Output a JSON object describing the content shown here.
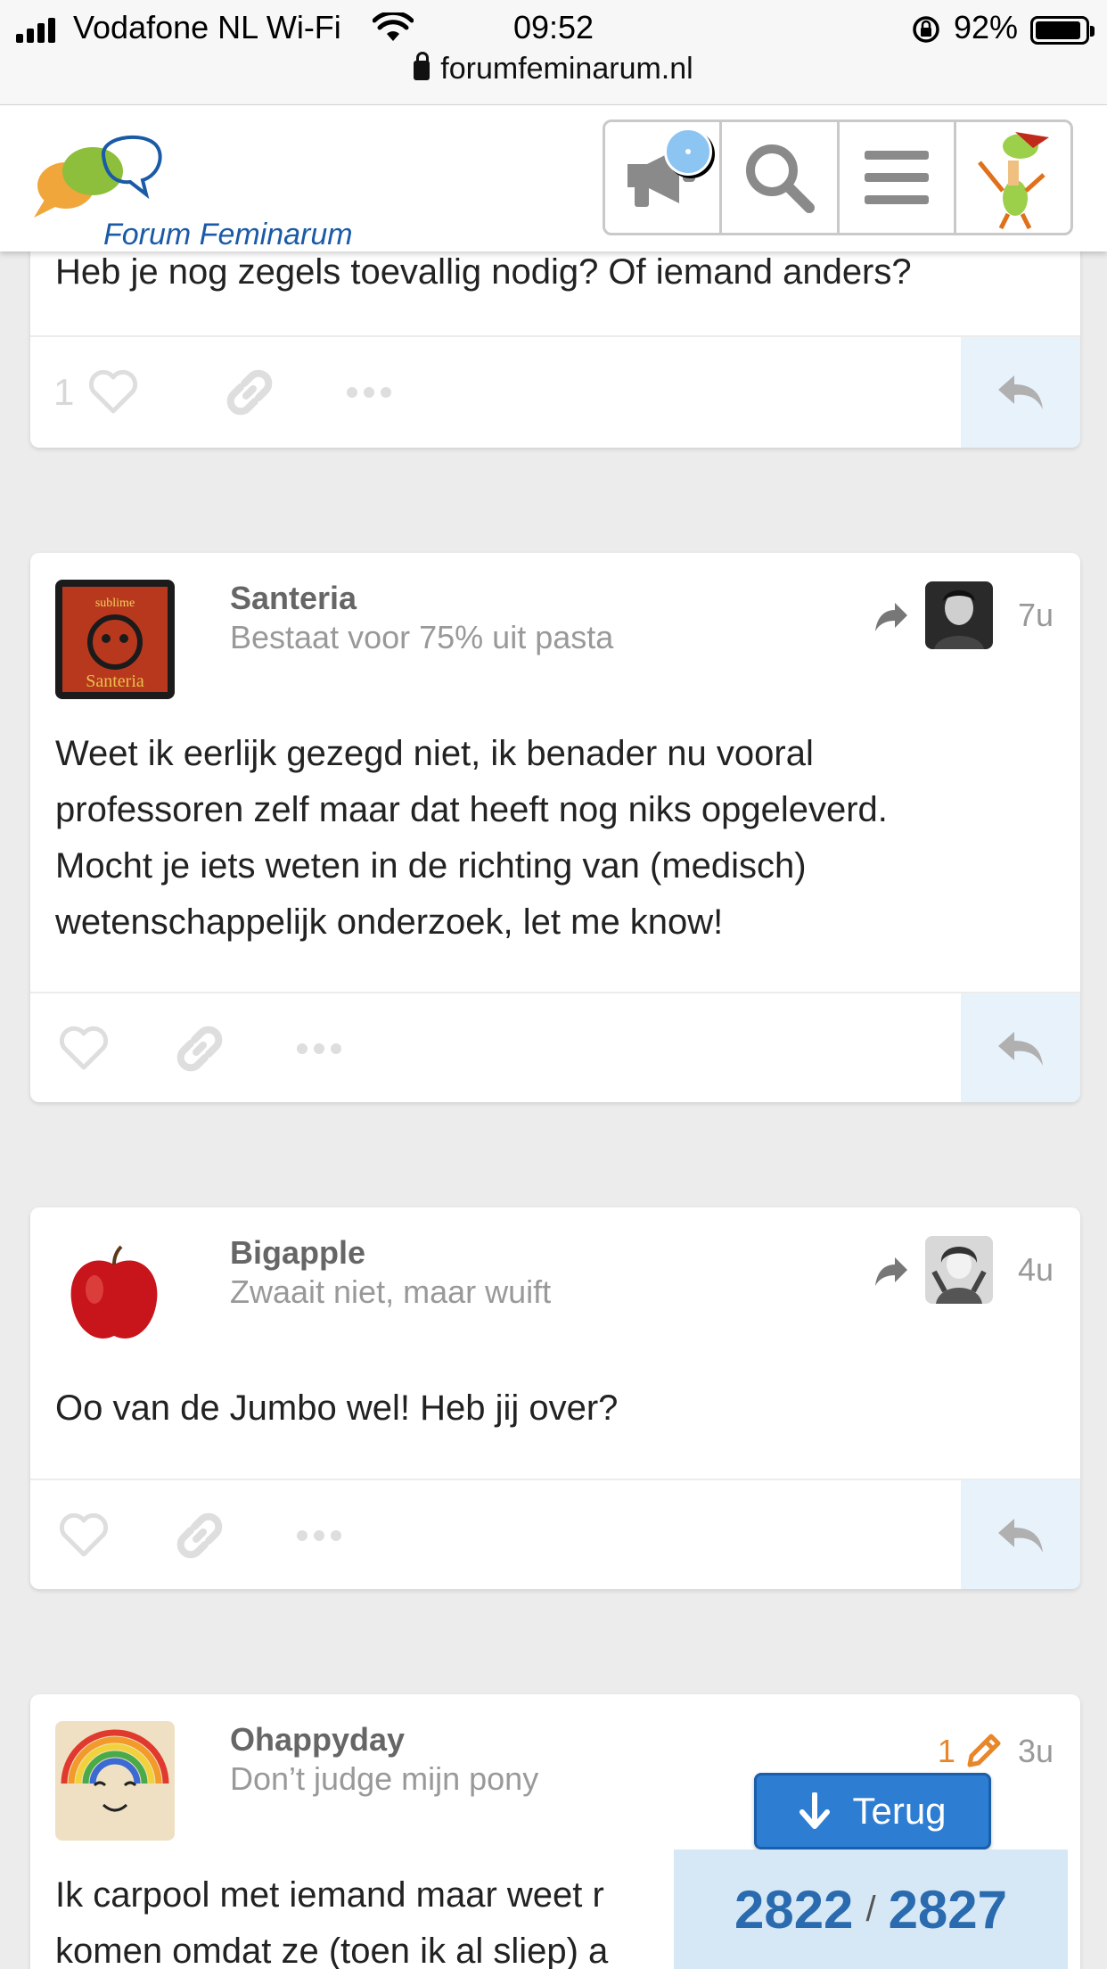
{
  "status_bar": {
    "carrier": "Vodafone NL Wi-Fi",
    "time": "09:52",
    "battery": "92%",
    "url": "forumfeminarum.nl"
  },
  "header": {
    "logo_text": "Forum Feminarum",
    "buttons": [
      "megaphone-icon",
      "search-icon",
      "hamburger-menu-icon",
      "user-avatar-frog"
    ],
    "accent_color": "#2d7dd2"
  },
  "previous_post": {
    "text": "Heb je nog zegels toevallig nodig? Of iemand anders?",
    "like_count": "1"
  },
  "posts": [
    {
      "username": "Santeria",
      "title": "Bestaat voor 75% uit pasta",
      "age": "7u",
      "avatar_text_top": "sublime",
      "avatar_text_bottom": "Santeria",
      "lines": [
        "Weet ik eerlijk gezegd niet, ik benader nu vooral",
        "professoren zelf maar dat heeft nog niks opgeleverd.",
        "Mocht je iets weten in de richting van (medisch)",
        "wetenschappelijk onderzoek, let me know!"
      ]
    },
    {
      "username": "Bigapple",
      "title": "Zwaait niet, maar wuift",
      "age": "4u",
      "lines": [
        "Oo van de Jumbo wel! Heb jij over?"
      ]
    },
    {
      "username": "Ohappyday",
      "title": "Don’t judge mijn pony",
      "age": "3u",
      "edit_count": "1",
      "lines": [
        "Ik carpool met iemand maar weet r",
        "komen omdat ze (toen ik al sliep) a"
      ]
    }
  ],
  "floating": {
    "back_label": "Terug",
    "current": "2822",
    "separator": "/",
    "total": "2827"
  }
}
